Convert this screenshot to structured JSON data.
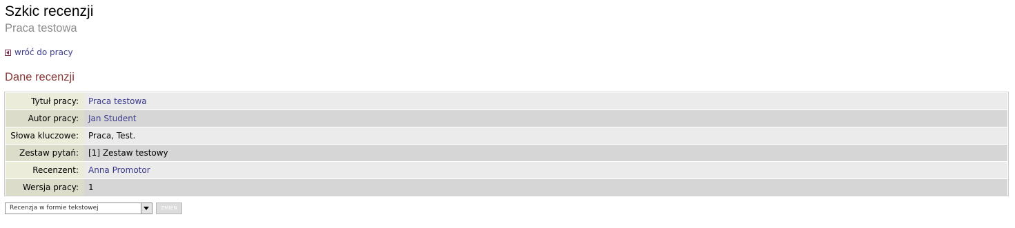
{
  "page": {
    "title": "Szkic recenzji",
    "subtitle": "Praca testowa"
  },
  "back_link": {
    "label": "wróć do pracy",
    "icon": "back-arrow-icon"
  },
  "section": {
    "title": "Dane recenzji"
  },
  "review_data": {
    "rows": [
      {
        "label": "Tytuł pracy:",
        "value": "Praca testowa",
        "is_link": true
      },
      {
        "label": "Autor pracy:",
        "value": "Jan Student",
        "is_link": true
      },
      {
        "label": "Słowa kluczowe:",
        "value": "Praca, Test.",
        "is_link": false
      },
      {
        "label": "Zestaw pytań:",
        "value": "[1] Zestaw testowy",
        "is_link": false
      },
      {
        "label": "Recenzent:",
        "value": "Anna Promotor",
        "is_link": true
      },
      {
        "label": "Wersja pracy:",
        "value": "1",
        "is_link": false
      }
    ]
  },
  "controls": {
    "review_format_select": {
      "selected": "Recenzja w formie tekstowej"
    },
    "change_button_label": "ZMIEŃ"
  },
  "colors": {
    "link": "#3a3a8c",
    "section_title": "#8a3a3a",
    "subtitle": "#8c8c8c"
  }
}
